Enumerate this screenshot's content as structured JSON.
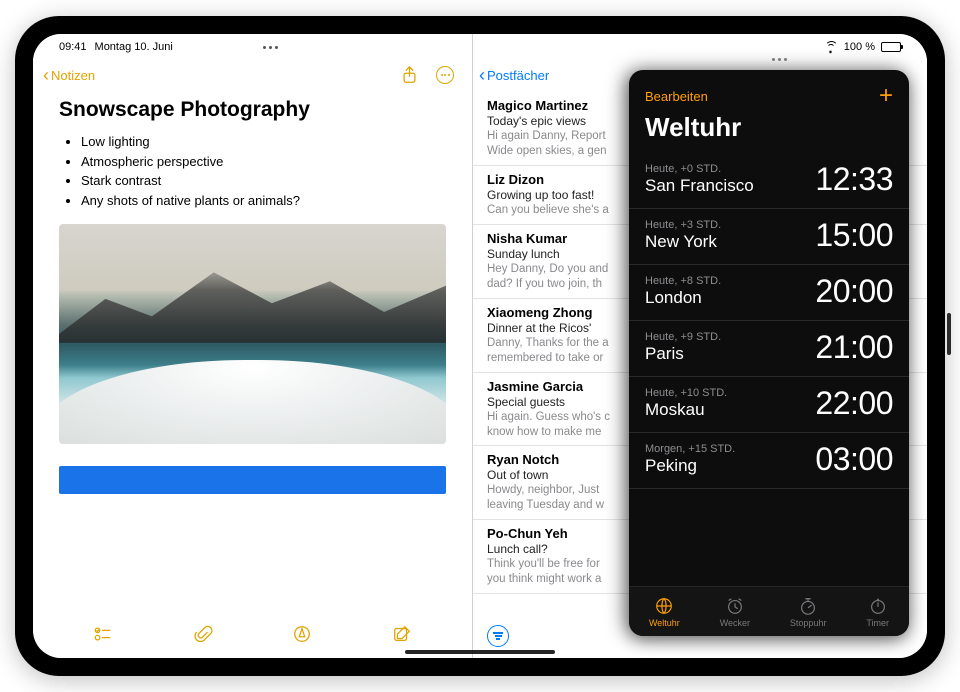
{
  "status": {
    "time": "09:41",
    "date": "Montag 10. Juni",
    "battery_text": "100 %"
  },
  "notes": {
    "back_label": "Notizen",
    "title": "Snowscape Photography",
    "bullets": [
      "Low lighting",
      "Atmospheric perspective",
      "Stark contrast",
      "Any shots of native plants or animals?"
    ]
  },
  "mail": {
    "back_label": "Postfächer",
    "items": [
      {
        "sender": "Magico Martinez",
        "subject": "Today's epic views",
        "preview1": "Hi again Danny, Report",
        "preview2": "Wide open skies, a gen"
      },
      {
        "sender": "Liz Dizon",
        "subject": "Growing up too fast!",
        "preview1": "Can you believe she's a",
        "preview2": ""
      },
      {
        "sender": "Nisha Kumar",
        "subject": "Sunday lunch",
        "preview1": "Hey Danny, Do you and",
        "preview2": "dad? If you two join, th"
      },
      {
        "sender": "Xiaomeng Zhong",
        "subject": "Dinner at the Ricos'",
        "preview1": "Danny, Thanks for the a",
        "preview2": "remembered to take or"
      },
      {
        "sender": "Jasmine Garcia",
        "subject": "Special guests",
        "preview1": "Hi again. Guess who's c",
        "preview2": "know how to make me"
      },
      {
        "sender": "Ryan Notch",
        "subject": "Out of town",
        "preview1": "Howdy, neighbor, Just",
        "preview2": "leaving Tuesday and w"
      },
      {
        "sender": "Po-Chun Yeh",
        "subject": "Lunch call?",
        "preview1": "Think you'll be free for",
        "preview2": "you think might work a"
      }
    ]
  },
  "clock": {
    "edit_label": "Bearbeiten",
    "title": "Weltuhr",
    "cities": [
      {
        "offset": "Heute, +0 STD.",
        "city": "San Francisco",
        "time": "12:33"
      },
      {
        "offset": "Heute, +3 STD.",
        "city": "New York",
        "time": "15:00"
      },
      {
        "offset": "Heute, +8 STD.",
        "city": "London",
        "time": "20:00"
      },
      {
        "offset": "Heute, +9 STD.",
        "city": "Paris",
        "time": "21:00"
      },
      {
        "offset": "Heute, +10 STD.",
        "city": "Moskau",
        "time": "22:00"
      },
      {
        "offset": "Morgen, +15 STD.",
        "city": "Peking",
        "time": "03:00"
      }
    ],
    "tabs": [
      {
        "id": "weltuhr",
        "label": "Weltuhr",
        "active": true
      },
      {
        "id": "wecker",
        "label": "Wecker",
        "active": false
      },
      {
        "id": "stoppuhr",
        "label": "Stoppuhr",
        "active": false
      },
      {
        "id": "timer",
        "label": "Timer",
        "active": false
      }
    ]
  }
}
